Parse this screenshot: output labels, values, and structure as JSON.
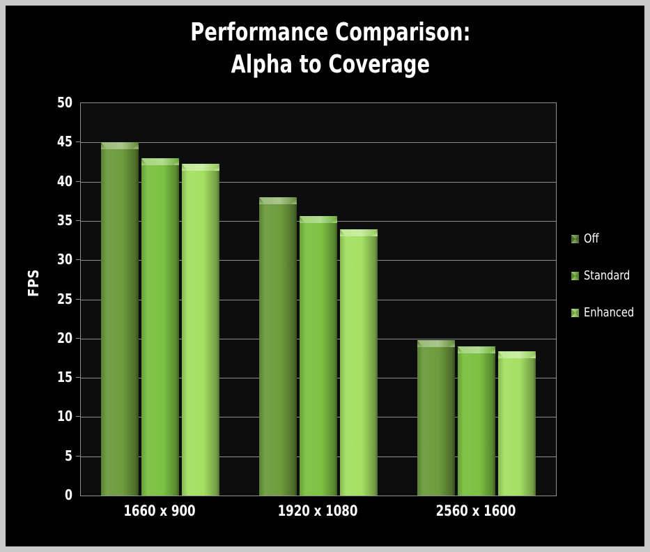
{
  "title": "Performance Comparison:\nAlpha to Coverage",
  "frame": {
    "border_color": "#c9c9c9",
    "background_color": "#000000",
    "plot_background_color": "#0d0d0d",
    "gridline_color": "#8f8f8f"
  },
  "chart_data": {
    "type": "bar",
    "title": "Performance Comparison: Alpha to Coverage",
    "xlabel": "",
    "ylabel": "FPS",
    "categories": [
      "1660 x 900",
      "1920 x 1080",
      "2560 x 1600"
    ],
    "series": [
      {
        "name": "Off",
        "color": "#6d9c3d",
        "values": [
          45.0,
          38.0,
          19.8
        ]
      },
      {
        "name": "Standard",
        "color": "#7cc242",
        "values": [
          43.0,
          35.6,
          19.0
        ]
      },
      {
        "name": "Enhanced",
        "color": "#a4e063",
        "values": [
          42.3,
          33.9,
          18.4
        ]
      }
    ],
    "ylim": [
      0,
      50
    ],
    "ytick_step": 5,
    "yticks": [
      "0",
      "5",
      "10",
      "15",
      "20",
      "25",
      "30",
      "35",
      "40",
      "45",
      "50"
    ],
    "grid": true,
    "legend_position": "right"
  }
}
